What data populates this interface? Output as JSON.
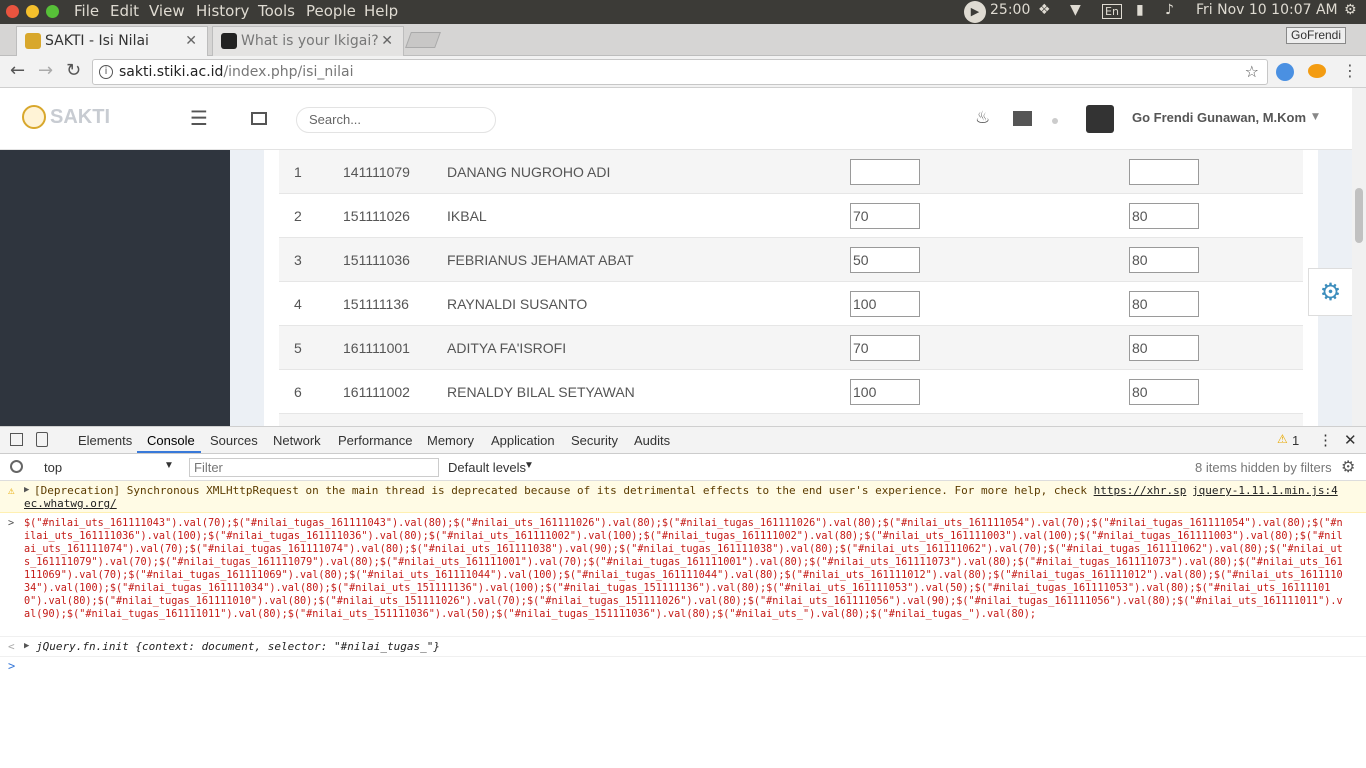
{
  "os": {
    "menus": [
      "File",
      "Edit",
      "View",
      "History",
      "Tools",
      "People",
      "Help"
    ],
    "timer": "25:00",
    "lang": "En",
    "clock": "Fri Nov 10 10:07 AM"
  },
  "browser": {
    "tabs": [
      {
        "title": "SAKTI - Isi Nilai"
      },
      {
        "title": "What is your Ikigai?"
      }
    ],
    "profile": "GoFrendi",
    "url_host": "sakti.stiki.ac.id",
    "url_path": "/index.php/isi_nilai"
  },
  "site": {
    "logo": "SAKTI",
    "search_placeholder": "Search...",
    "user": "Go Frendi Gunawan, M.Kom"
  },
  "students": [
    {
      "no": "1",
      "nrp": "141111079",
      "name": "DANANG NUGROHO ADI",
      "uts": "",
      "tugas": ""
    },
    {
      "no": "2",
      "nrp": "151111026",
      "name": "IKBAL",
      "uts": "70",
      "tugas": "80"
    },
    {
      "no": "3",
      "nrp": "151111036",
      "name": "FEBRIANUS JEHAMAT ABAT",
      "uts": "50",
      "tugas": "80"
    },
    {
      "no": "4",
      "nrp": "151111136",
      "name": "RAYNALDI SUSANTO",
      "uts": "100",
      "tugas": "80"
    },
    {
      "no": "5",
      "nrp": "161111001",
      "name": "ADITYA FA'ISROFI",
      "uts": "70",
      "tugas": "80"
    },
    {
      "no": "6",
      "nrp": "161111002",
      "name": "RENALDY BILAL SETYAWAN",
      "uts": "100",
      "tugas": "80"
    }
  ],
  "devtools": {
    "tabs": [
      "Elements",
      "Console",
      "Sources",
      "Network",
      "Performance",
      "Memory",
      "Application",
      "Security",
      "Audits"
    ],
    "warning_count": "1",
    "context": "top",
    "filter_placeholder": "Filter",
    "levels": "Default levels",
    "hidden": "8 items hidden by filters",
    "warning_text": "[Deprecation] Synchronous XMLHttpRequest on the main thread is deprecated because of its detrimental effects to the end user's experience. For more help, check",
    "warning_link": "https://xhr.sp",
    "warning_link2": "ec.whatwg.org/",
    "warning_source": "jquery-1.11.1.min.js:4",
    "command": "$(\"#nilai_uts_161111043\").val(70);$(\"#nilai_tugas_161111043\").val(80);$(\"#nilai_uts_161111026\").val(80);$(\"#nilai_tugas_161111026\").val(80);$(\"#nilai_uts_161111054\").val(70);$(\"#nilai_tugas_161111054\").val(80);$(\"#nilai_uts_161111036\").val(100);$(\"#nilai_tugas_161111036\").val(80);$(\"#nilai_uts_161111002\").val(100);$(\"#nilai_tugas_161111002\").val(80);$(\"#nilai_uts_161111003\").val(100);$(\"#nilai_tugas_161111003\").val(80);$(\"#nilai_uts_161111074\").val(70);$(\"#nilai_tugas_161111074\").val(80);$(\"#nilai_uts_161111038\").val(90);$(\"#nilai_tugas_161111038\").val(80);$(\"#nilai_uts_161111062\").val(70);$(\"#nilai_tugas_161111062\").val(80);$(\"#nilai_uts_161111079\").val(70);$(\"#nilai_tugas_161111079\").val(80);$(\"#nilai_uts_161111001\").val(70);$(\"#nilai_tugas_161111001\").val(80);$(\"#nilai_uts_161111073\").val(80);$(\"#nilai_tugas_161111073\").val(80);$(\"#nilai_uts_161111069\").val(70);$(\"#nilai_tugas_161111069\").val(80);$(\"#nilai_uts_161111044\").val(100);$(\"#nilai_tugas_161111044\").val(80);$(\"#nilai_uts_161111012\").val(80);$(\"#nilai_tugas_161111012\").val(80);$(\"#nilai_uts_161111034\").val(100);$(\"#nilai_tugas_161111034\").val(80);$(\"#nilai_uts_151111136\").val(100);$(\"#nilai_tugas_151111136\").val(80);$(\"#nilai_uts_161111053\").val(50);$(\"#nilai_tugas_161111053\").val(80);$(\"#nilai_uts_161111010\").val(80);$(\"#nilai_tugas_161111010\").val(80);$(\"#nilai_uts_151111026\").val(70);$(\"#nilai_tugas_151111026\").val(80);$(\"#nilai_uts_161111056\").val(90);$(\"#nilai_tugas_161111056\").val(80);$(\"#nilai_uts_161111011\").val(90);$(\"#nilai_tugas_161111011\").val(80);$(\"#nilai_uts_151111036\").val(50);$(\"#nilai_tugas_151111036\").val(80);$(\"#nilai_uts_\").val(80);$(\"#nilai_tugas_\").val(80);",
    "result": "jQuery.fn.init {context: document, selector: \"#nilai_tugas_\"}"
  }
}
